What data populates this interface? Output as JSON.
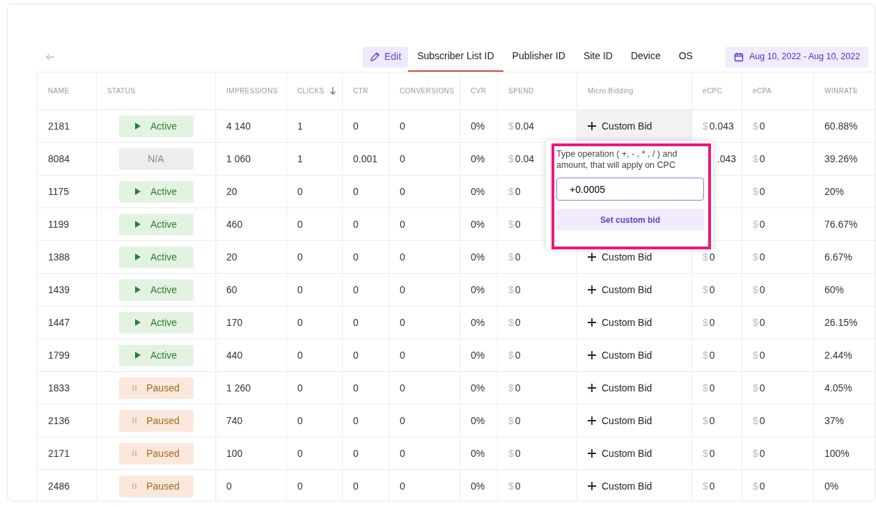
{
  "toolbar": {
    "edit_button": "Edit",
    "tabs": [
      {
        "label": "Subscriber List ID",
        "selected": true
      },
      {
        "label": "Publisher ID",
        "selected": false
      },
      {
        "label": "Site ID",
        "selected": false
      },
      {
        "label": "Device",
        "selected": false
      },
      {
        "label": "OS",
        "selected": false
      }
    ],
    "date_range": "Aug 10, 2022 - Aug 10, 2022"
  },
  "table": {
    "columns": [
      {
        "label": "NAME"
      },
      {
        "label": "STATUS"
      },
      {
        "label": "IMPRESSIONS"
      },
      {
        "label": "CLICKS",
        "sorted": true
      },
      {
        "label": "CTR"
      },
      {
        "label": "CONVERSIONS"
      },
      {
        "label": "CVR"
      },
      {
        "label": "SPEND"
      },
      {
        "label": "Micro Bidding"
      },
      {
        "label": "eCPC"
      },
      {
        "label": "eCPA"
      },
      {
        "label": "WINRATE"
      }
    ],
    "rows": [
      {
        "name": "2181",
        "status": {
          "kind": "active",
          "label": "Active"
        },
        "impressions": "4 140",
        "clicks": "1",
        "ctr": "0",
        "conversions": "0",
        "cvr": "0%",
        "spend": {
          "currency": "$",
          "value": "0.04"
        },
        "micro_bidding": {
          "label": "Custom Bid",
          "highlighted": true
        },
        "ecpc": {
          "currency": "$",
          "value": "0.043"
        },
        "ecpa": {
          "currency": "$",
          "value": "0"
        },
        "winrate": "60.88%"
      },
      {
        "name": "8084",
        "status": {
          "kind": "na",
          "label": "N/A"
        },
        "impressions": "1 060",
        "clicks": "1",
        "ctr": "0.001",
        "conversions": "0",
        "cvr": "0%",
        "spend": {
          "currency": "$",
          "value": "0.04"
        },
        "ecpc": {
          "value": ".043"
        },
        "ecpa": {
          "currency": "$",
          "value": "0"
        },
        "winrate": "39.26%"
      },
      {
        "name": "1175",
        "status": {
          "kind": "active",
          "label": "Active"
        },
        "impressions": "20",
        "clicks": "0",
        "ctr": "0",
        "conversions": "0",
        "cvr": "0%",
        "spend": {
          "currency": "$",
          "value": "0"
        },
        "ecpa": {
          "currency": "$",
          "value": "0"
        },
        "winrate": "20%"
      },
      {
        "name": "1199",
        "status": {
          "kind": "active",
          "label": "Active"
        },
        "impressions": "460",
        "clicks": "0",
        "ctr": "0",
        "conversions": "0",
        "cvr": "0%",
        "spend": {
          "currency": "$",
          "value": "0"
        },
        "ecpa": {
          "currency": "$",
          "value": "0"
        },
        "winrate": "76.67%"
      },
      {
        "name": "1388",
        "status": {
          "kind": "active",
          "label": "Active"
        },
        "impressions": "20",
        "clicks": "0",
        "ctr": "0",
        "conversions": "0",
        "cvr": "0%",
        "spend": {
          "currency": "$",
          "value": "0"
        },
        "micro_bidding": {
          "label": "Custom Bid",
          "highlighted": false
        },
        "ecpc": {
          "currency": "$",
          "value": "0"
        },
        "ecpa": {
          "currency": "$",
          "value": "0"
        },
        "winrate": "6.67%"
      },
      {
        "name": "1439",
        "status": {
          "kind": "active",
          "label": "Active"
        },
        "impressions": "60",
        "clicks": "0",
        "ctr": "0",
        "conversions": "0",
        "cvr": "0%",
        "spend": {
          "currency": "$",
          "value": "0"
        },
        "micro_bidding": {
          "label": "Custom Bid",
          "highlighted": false
        },
        "ecpc": {
          "currency": "$",
          "value": "0"
        },
        "ecpa": {
          "currency": "$",
          "value": "0"
        },
        "winrate": "60%"
      },
      {
        "name": "1447",
        "status": {
          "kind": "active",
          "label": "Active"
        },
        "impressions": "170",
        "clicks": "0",
        "ctr": "0",
        "conversions": "0",
        "cvr": "0%",
        "spend": {
          "currency": "$",
          "value": "0"
        },
        "micro_bidding": {
          "label": "Custom Bid",
          "highlighted": false
        },
        "ecpc": {
          "currency": "$",
          "value": "0"
        },
        "ecpa": {
          "currency": "$",
          "value": "0"
        },
        "winrate": "26.15%"
      },
      {
        "name": "1799",
        "status": {
          "kind": "active",
          "label": "Active"
        },
        "impressions": "440",
        "clicks": "0",
        "ctr": "0",
        "conversions": "0",
        "cvr": "0%",
        "spend": {
          "currency": "$",
          "value": "0"
        },
        "micro_bidding": {
          "label": "Custom Bid",
          "highlighted": false
        },
        "ecpc": {
          "currency": "$",
          "value": "0"
        },
        "ecpa": {
          "currency": "$",
          "value": "0"
        },
        "winrate": "2.44%"
      },
      {
        "name": "1833",
        "status": {
          "kind": "paused",
          "label": "Paused"
        },
        "impressions": "1 260",
        "clicks": "0",
        "ctr": "0",
        "conversions": "0",
        "cvr": "0%",
        "spend": {
          "currency": "$",
          "value": "0"
        },
        "micro_bidding": {
          "label": "Custom Bid",
          "highlighted": false
        },
        "ecpc": {
          "currency": "$",
          "value": "0"
        },
        "ecpa": {
          "currency": "$",
          "value": "0"
        },
        "winrate": "4.05%"
      },
      {
        "name": "2136",
        "status": {
          "kind": "paused",
          "label": "Paused"
        },
        "impressions": "740",
        "clicks": "0",
        "ctr": "0",
        "conversions": "0",
        "cvr": "0%",
        "spend": {
          "currency": "$",
          "value": "0"
        },
        "micro_bidding": {
          "label": "Custom Bid",
          "highlighted": false
        },
        "ecpc": {
          "currency": "$",
          "value": "0"
        },
        "ecpa": {
          "currency": "$",
          "value": "0"
        },
        "winrate": "37%"
      },
      {
        "name": "2171",
        "status": {
          "kind": "paused",
          "label": "Paused"
        },
        "impressions": "100",
        "clicks": "0",
        "ctr": "0",
        "conversions": "0",
        "cvr": "0%",
        "spend": {
          "currency": "$",
          "value": "0"
        },
        "micro_bidding": {
          "label": "Custom Bid",
          "highlighted": false
        },
        "ecpc": {
          "currency": "$",
          "value": "0"
        },
        "ecpa": {
          "currency": "$",
          "value": "0"
        },
        "winrate": "100%"
      },
      {
        "name": "2486",
        "status": {
          "kind": "paused",
          "label": "Paused"
        },
        "impressions": "0",
        "clicks": "0",
        "ctr": "0",
        "conversions": "0",
        "cvr": "0%",
        "spend": {
          "currency": "$",
          "value": "0"
        },
        "micro_bidding": {
          "label": "Custom Bid",
          "highlighted": false
        },
        "ecpc": {
          "currency": "$",
          "value": "0"
        },
        "ecpa": {
          "currency": "$",
          "value": "0"
        },
        "winrate": "0%"
      }
    ]
  },
  "bid_popover": {
    "hint": "Type operation ( +, - , * , / ) and amount, that will apply on CPC",
    "value": "+0.0005",
    "button": "Set custom bid"
  }
}
